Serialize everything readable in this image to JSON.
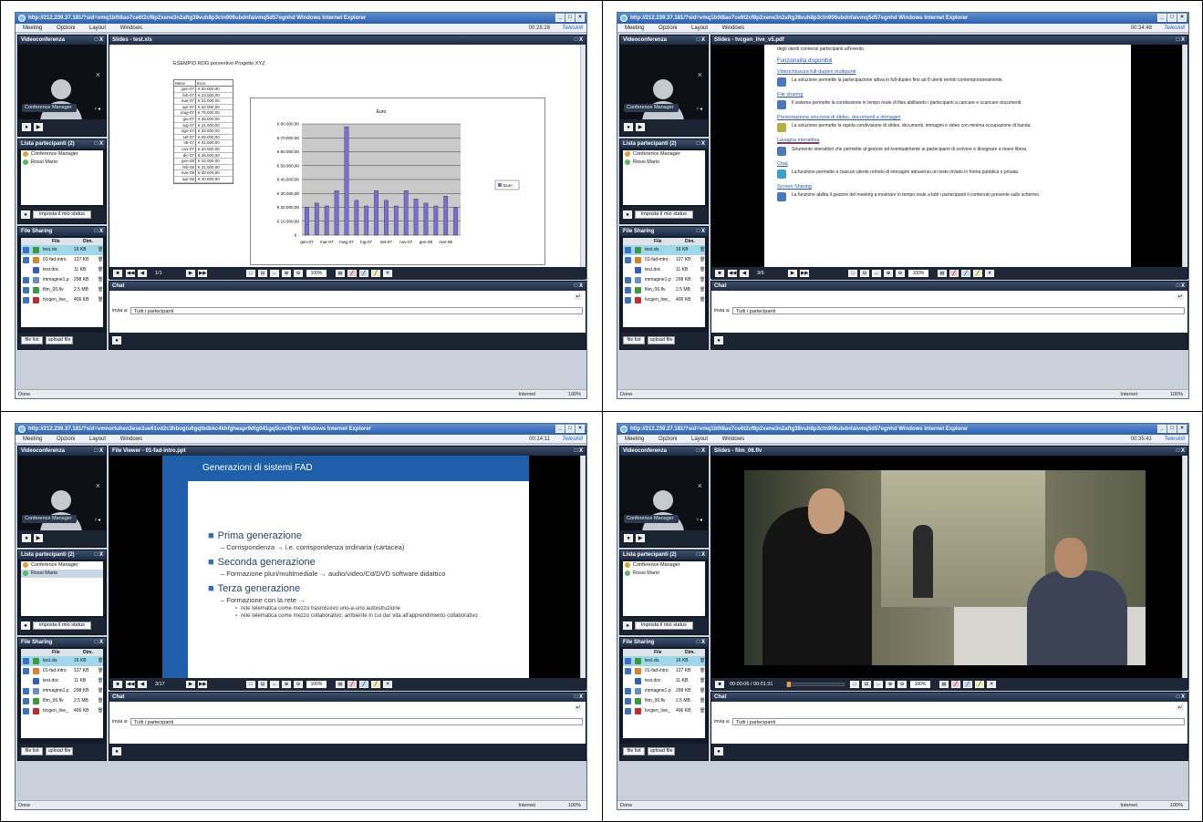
{
  "colors": {
    "titlebar": "#2d5fae",
    "panel": "#111a26",
    "accent_selected": "#9fd8ea",
    "chart_bar": "#7a6ed6",
    "slide_blue": "#1f5ea8"
  },
  "common": {
    "ie_suffix": "Windows Internet Explorer",
    "menu": [
      "Meeting",
      "Opzioni",
      "Layout",
      "Windows"
    ],
    "brand": "Teleskill",
    "video_panel_title": "Videoconferenza",
    "participant_name": "Conference Manager",
    "participants_title": "Lista partecipanti (2)",
    "participants": [
      "Conference Manager",
      "Rossi Mario"
    ],
    "status_button": "imposta il mio status",
    "filesharing_title": "File Sharing",
    "file_col": "File",
    "dim_col": "Dim.",
    "files": [
      {
        "name": "test.xls",
        "size": "16 KB"
      },
      {
        "name": "01-fad-intro.",
        "size": "127 KB"
      },
      {
        "name": "test.doc",
        "size": "11 KB"
      },
      {
        "name": "immagine1.p",
        "size": "298 KB"
      },
      {
        "name": "film_06.flv",
        "size": "2.5 MB"
      },
      {
        "name": "tvcgen_live_",
        "size": "406 KB"
      }
    ],
    "filelist_button": "file list",
    "upload_button": "upload file",
    "chat_title": "Chat",
    "chat_send_label": "invia a:",
    "chat_send_target": "Tutti i partecipanti",
    "status_done": "Done",
    "status_zone": "Internet",
    "status_zoom": "100%"
  },
  "screens": [
    {
      "url": "http://212.239.37.181/?sid=vmq1b0t8ao7ce6t2cf8p2xene3n2aftg38vuh8p3ctn906ubdnfaivmq5d57egnhd",
      "clock": "00:28:28",
      "main_title": "Slides - test.xls",
      "page": "1/1",
      "zoom": "100%",
      "sheet_title": "ESEMPIO ROG preventivo Progetto XYZ",
      "sheet_headers": [
        "Mese",
        "Euro"
      ],
      "legend": "Euro",
      "chart_data": {
        "type": "bar",
        "title": "Euro",
        "categories": [
          "gen-07",
          "feb-07",
          "mar-07",
          "apr-07",
          "mag-07",
          "giu-07",
          "lug-07",
          "ago-07",
          "set-07",
          "ott-07",
          "nov-07",
          "dic-07",
          "gen-08",
          "feb-08",
          "mar-08",
          "apr-08"
        ],
        "tick_labels": [
          "gen-07",
          "mar-07",
          "mag-07",
          "lug-07",
          "set-07",
          "nov-07",
          "gen-08",
          "mar-08"
        ],
        "values": [
          20000,
          23000,
          21000,
          32000,
          78000,
          25000,
          21000,
          32000,
          25000,
          21000,
          32000,
          26000,
          23000,
          21000,
          28000,
          20000
        ],
        "value_labels": [
          "€ 20.000,00",
          "€ 23.000,00",
          "€ 21.000,00",
          "€ 32.000,00",
          "€ 78.000,00",
          "€ 25.000,00",
          "€ 21.000,00",
          "€ 32.000,00",
          "€ 25.000,00",
          "€ 21.000,00",
          "€ 32.000,00",
          "€ 26.000,00",
          "€ 23.000,00",
          "€ 21.000,00",
          "€ 28.000,00",
          "€ 20.000,00"
        ],
        "y_ticks": [
          "€ 80.000,00",
          "€ 70.000,00",
          "€ 60.000,00",
          "€ 50.000,00",
          "€ 40.000,00",
          "€ 30.000,00",
          "€ 20.000,00",
          "€ 10.000,00",
          "€ -"
        ],
        "ylim": [
          0,
          80000
        ]
      }
    },
    {
      "url": "http://212.239.37.181/?sid=vmq1b0t8ao7ce6t2cf8p2xene3n2aftg38vuh8p3ctn906ubdnfaivmq5d57egnhd",
      "clock": "00:34:48",
      "main_title": "Slides - tvcgen_live_v5.pdf",
      "page": "3/6",
      "zoom": "100%",
      "doc_top": "degli utenti connessi partecipanti all'evento.",
      "doc_heading": "Funzionalità disponibili",
      "sections": [
        {
          "title": "Videochiusura full-duplex multipunti",
          "text": "La soluzione permette la partecipazione attiva in full-duplex fino ad 8 utenti remoti contemporaneamente."
        },
        {
          "title": "File sharing",
          "text": "Il sistema permette la condivisione in tempo reale di files abilitando i partecipanti a caricare e scaricare documenti."
        },
        {
          "title": "Presentazione sincrona di slides, documenti e immagini",
          "text": "La soluzione permette la rapida condivisione di slides, documenti, immagini e video con minima occupazione di banda."
        },
        {
          "title": "Lavagna interattiva",
          "text": "Strumento interattivo che permette al gestore ed eventualmente ai partecipanti di scrivere e disegnare a mano libera."
        },
        {
          "title": "Chat",
          "text": "La funzione permette a ciascun utente remoto di interagire attraverso un testo inviato in forma pubblica o privata."
        },
        {
          "title": "Screen Sharing",
          "text": "La funzione abilita il gestore del meeting a mostrare in tempo reale a tutti i partecipanti il contenuto presente sullo schermo."
        }
      ]
    },
    {
      "url": "http://212.239.37.181/?sid=vmnortuhen3ese3ue61vd2c3hbogtu6gqlbdbkc4khfgheapr9dtg041gq5cncfljvm",
      "clock": "00:14:11",
      "main_title": "File Viewer - 01-fad-intro.ppt",
      "page": "3/17",
      "zoom": "100%",
      "slide_title": "Generazioni di sistemi FAD",
      "bullets": [
        {
          "level": 1,
          "text": "Prima generazione"
        },
        {
          "level": 2,
          "text": "– Corrispondenza → i.e. corrispondenza ordinaria (cartacea)"
        },
        {
          "level": 1,
          "text": "Seconda generazione"
        },
        {
          "level": 2,
          "text": "– Formazione pluri/multimediale → audio/video/Cd/DVD software didattico"
        },
        {
          "level": 1,
          "text": "Terza generazione"
        },
        {
          "level": 2,
          "text": "– Formazione con la rete →"
        },
        {
          "level": 3,
          "text": "rete telematica come mezzo trasmissivo uno-a-uno:autoistruzione"
        },
        {
          "level": 3,
          "text": "rete telematica come mezzo collaborativo: ambiente in cui dar vita all'apprendimento collaborativo"
        }
      ]
    },
    {
      "url": "http://212.239.37.181/?sid=vmq1b0t8ao7ce6t2cf8p2xene3n2aftg38vuh8p3ctn906ubdnfaivmq5d57egnhd",
      "clock": "00:35:41",
      "main_title": "Slides - film_06.flv",
      "time_readout": "00:00:06 / 00:01:31",
      "zoom": "100%"
    }
  ]
}
